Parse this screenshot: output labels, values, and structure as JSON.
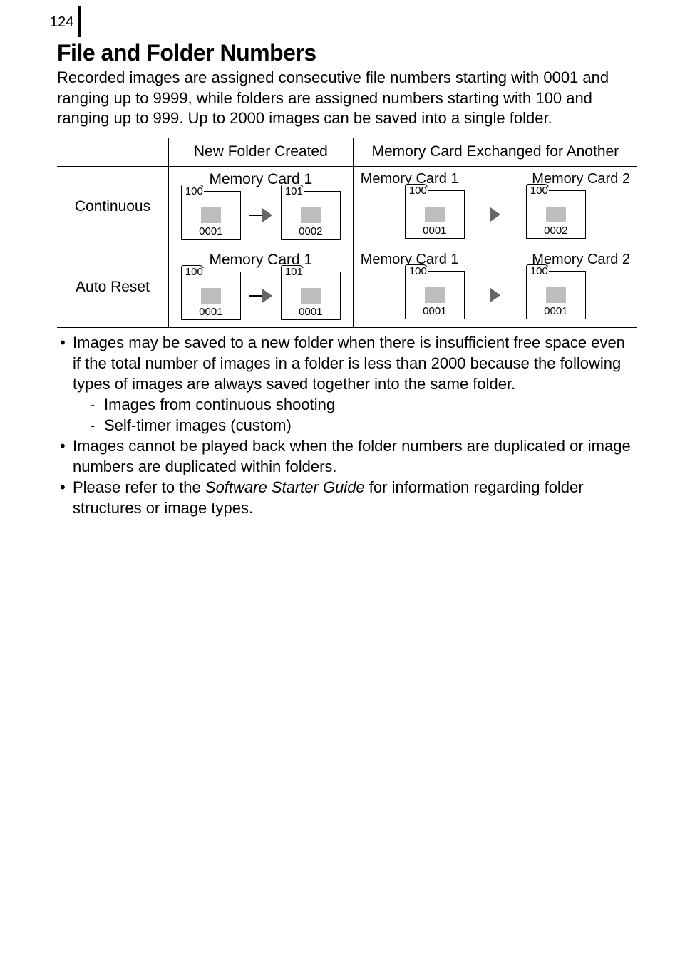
{
  "page_number": "124",
  "heading": "File and Folder Numbers",
  "intro": "Recorded images are assigned consecutive file numbers starting with 0001 and ranging up to 9999, while folders are assigned numbers starting with 100 and ranging up to 999. Up to 2000 images can be saved into a single folder.",
  "table": {
    "head_col1": "New Folder Created",
    "head_col2": "Memory Card Exchanged for Another",
    "row1_label": "Continuous",
    "row2_label": "Auto Reset",
    "mc1": "Memory Card 1",
    "mc2": "Memory Card 2",
    "continuous_col1": {
      "f1_tab": "100",
      "f1_num": "0001",
      "f2_tab": "101",
      "f2_num": "0002"
    },
    "continuous_col2": {
      "f1_tab": "100",
      "f1_num": "0001",
      "f2_tab": "100",
      "f2_num": "0002"
    },
    "autoreset_col1": {
      "f1_tab": "100",
      "f1_num": "0001",
      "f2_tab": "101",
      "f2_num": "0001"
    },
    "autoreset_col2": {
      "f1_tab": "100",
      "f1_num": "0001",
      "f2_tab": "100",
      "f2_num": "0001"
    }
  },
  "notes": {
    "n1": "Images may be saved to a new folder when there is insufficient free space even if the total number of images in a folder is less than 2000 because the following types of images are always saved together into the same folder.",
    "n1a": "Images from continuous shooting",
    "n1b": "Self-timer images (custom)",
    "n2": "Images cannot be played back when the folder numbers are duplicated or image numbers are duplicated within folders.",
    "n3_pre": "Please refer to the ",
    "n3_em": "Software Starter Guide",
    "n3_post": " for information regarding folder structures or image types."
  }
}
